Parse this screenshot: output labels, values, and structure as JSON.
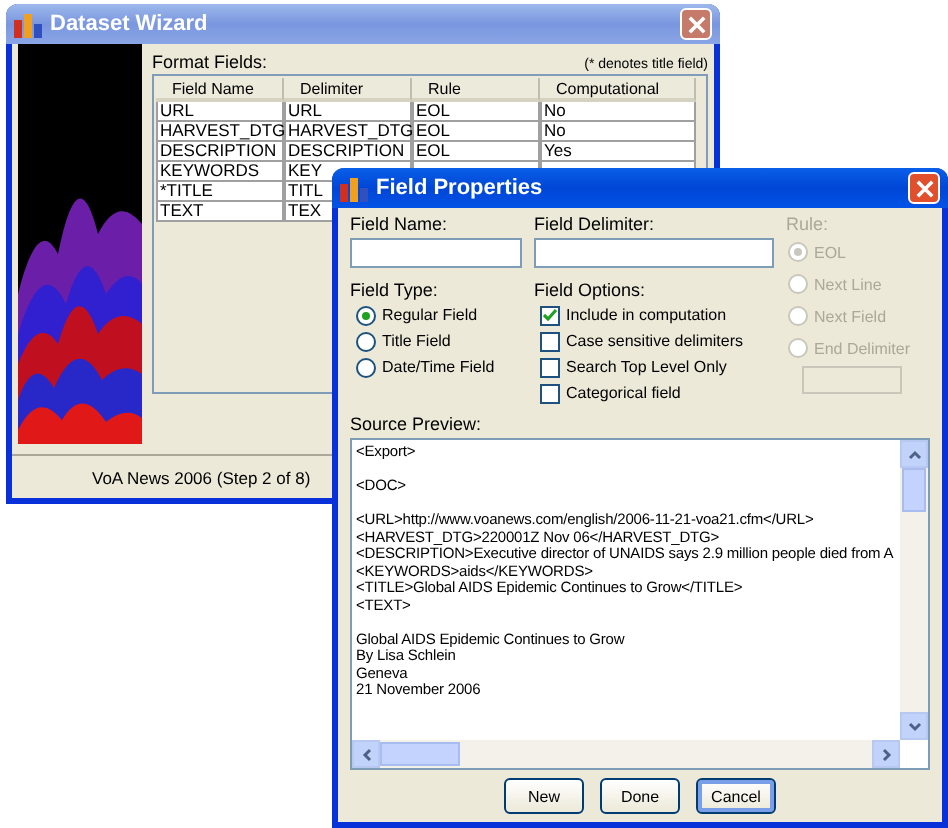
{
  "wizard": {
    "title": "Dataset Wizard",
    "fields_label": "Format Fields:",
    "note": "(* denotes title field)",
    "columns": [
      "Field Name",
      "Delimiter",
      "Rule",
      "Computational"
    ],
    "rows": [
      {
        "cells": [
          "URL",
          "URL",
          "EOL",
          "No"
        ]
      },
      {
        "cells": [
          "HARVEST_DTG",
          "HARVEST_DTG",
          "EOL",
          "No"
        ]
      },
      {
        "cells": [
          "DESCRIPTION",
          "DESCRIPTION",
          "EOL",
          "Yes"
        ]
      },
      {
        "cells": [
          "KEYWORDS",
          "KEY"
        ]
      },
      {
        "cells": [
          "*TITLE",
          "TITL"
        ]
      },
      {
        "cells": [
          "TEXT",
          "TEX"
        ]
      }
    ],
    "status": "VoA News 2006 (Step 2 of 8)"
  },
  "dialog": {
    "title": "Field Properties",
    "field_name_label": "Field Name:",
    "delimiter_label": "Field Delimiter:",
    "rule": {
      "label": "Rule:",
      "disabled": true,
      "options": [
        {
          "label": "EOL",
          "selected": true
        },
        {
          "label": "Next Line",
          "selected": false
        },
        {
          "label": "Next Field",
          "selected": false
        },
        {
          "label": "End Delimiter",
          "selected": false
        }
      ]
    },
    "field_type": {
      "label": "Field Type:",
      "options": [
        {
          "label": "Regular Field",
          "selected": true
        },
        {
          "label": "Title Field",
          "selected": false
        },
        {
          "label": "Date/Time Field",
          "selected": false
        }
      ]
    },
    "field_options": {
      "label": "Field Options:",
      "options": [
        {
          "label": "Include in computation",
          "checked": true
        },
        {
          "label": "Case sensitive delimiters",
          "checked": false
        },
        {
          "label": "Search Top Level Only",
          "checked": false
        },
        {
          "label": "Categorical field",
          "checked": false
        }
      ]
    },
    "preview_label": "Source Preview:",
    "preview_paragraphs": [
      [
        "<Export>"
      ],
      [
        "<DOC>"
      ],
      [
        "<URL>http://www.voanews.com/english/2006-11-21-voa21.cfm</URL>",
        "<HARVEST_DTG>220001Z Nov 06</HARVEST_DTG>",
        "<DESCRIPTION>Executive director of UNAIDS says 2.9 million people died from A",
        "<KEYWORDS>aids</KEYWORDS>",
        "<TITLE>Global AIDS Epidemic Continues to Grow</TITLE>",
        "<TEXT>"
      ],
      [
        "Global AIDS Epidemic Continues to Grow",
        "By Lisa Schlein",
        "Geneva",
        "21 November 2006"
      ]
    ],
    "buttons": [
      {
        "label": "New",
        "focused": false
      },
      {
        "label": "Done",
        "focused": false
      },
      {
        "label": "Cancel",
        "focused": true
      }
    ]
  }
}
